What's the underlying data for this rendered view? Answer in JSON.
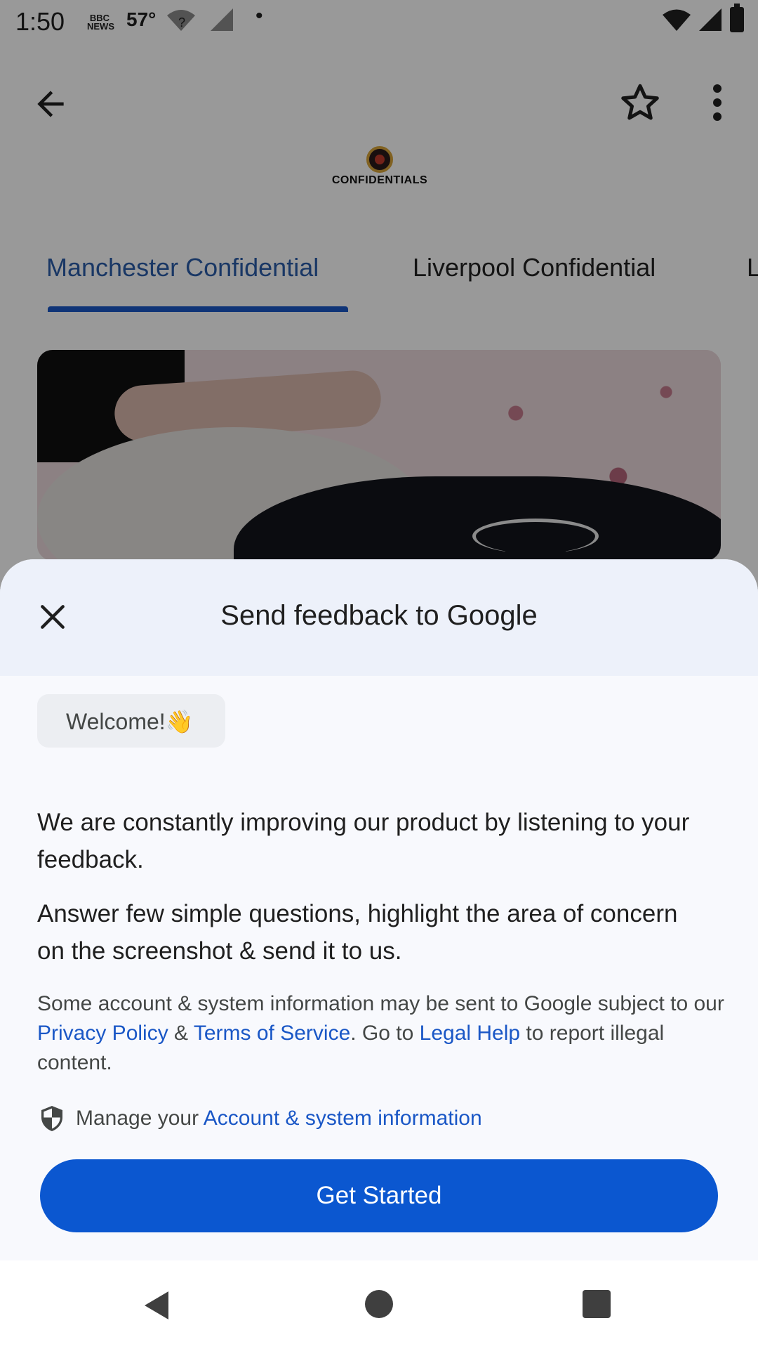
{
  "status_bar": {
    "time": "1:50",
    "news_icon_label": "BBC NEWS",
    "temperature": "57°",
    "wifi_status": "?",
    "dot": "•"
  },
  "app": {
    "logo_text": "CONFIDENTIALS",
    "tabs": [
      {
        "label": "Manchester Confidential",
        "active": true
      },
      {
        "label": "Liverpool Confidential",
        "active": false
      },
      {
        "label": "L",
        "active": false
      }
    ],
    "accent_color": "#1a57c6"
  },
  "sheet": {
    "title": "Send feedback to Google",
    "welcome": "Welcome!👋",
    "paragraph1": "We are constantly improving our product by listening to your feedback.",
    "paragraph2": "Answer few simple questions, highlight the area of concern on the screenshot & send it to us.",
    "legal": {
      "prefix": "Some account & system information may be sent to Google subject to our ",
      "privacy_link": "Privacy Policy",
      "amp": " & ",
      "terms_link": "Terms of Service",
      "middle": ". Go to ",
      "legal_link": "Legal Help",
      "suffix": " to report illegal content."
    },
    "manage": {
      "prefix": "Manage your ",
      "link": "Account & system information"
    },
    "cta_label": "Get Started",
    "cta_color": "#0b57d0"
  },
  "icons": {
    "back": "arrow-left",
    "star": "star-outline",
    "more": "more-vertical",
    "close": "close-x",
    "shield": "shield",
    "nav_back": "triangle-back",
    "nav_home": "circle-home",
    "nav_recent": "square-recents"
  }
}
